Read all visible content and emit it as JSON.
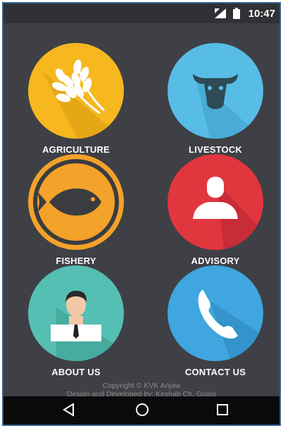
{
  "status_bar": {
    "time": "10:47"
  },
  "menu": {
    "agriculture": {
      "label": "AGRICULTURE",
      "icon": "wheat-icon",
      "color": "#f6b71f"
    },
    "livestock": {
      "label": "LIVESTOCK",
      "icon": "cow-head-icon",
      "color": "#57bde6"
    },
    "fishery": {
      "label": "FISHERY",
      "icon": "fish-icon",
      "color": "#f3a22a"
    },
    "advisory": {
      "label": "ADVISORY",
      "icon": "person-icon",
      "color": "#e2363f"
    },
    "about_us": {
      "label": "ABOUT US",
      "icon": "businessman-icon",
      "color": "#55bfb3"
    },
    "contact_us": {
      "label": "CONTACT US",
      "icon": "phone-icon",
      "color": "#3fa6df"
    }
  },
  "footer": {
    "copyright": "Copyright © KVK Anjaw",
    "developer": "Design and Developed by: Keshab Ch. Gogoi"
  },
  "nav_bar": {
    "back": "back-icon",
    "home": "home-icon",
    "recents": "recents-icon"
  }
}
